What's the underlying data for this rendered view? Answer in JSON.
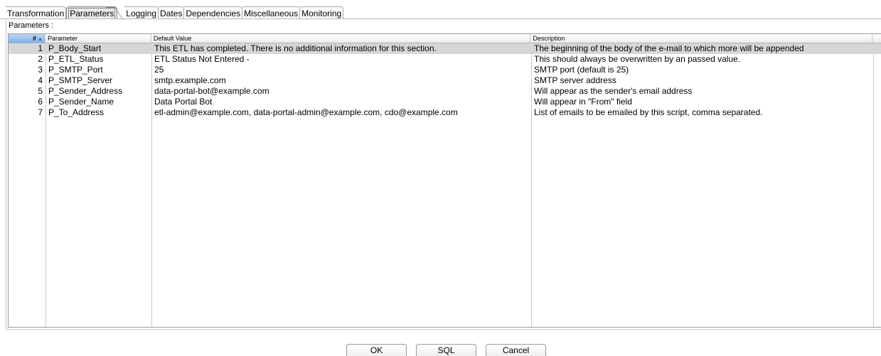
{
  "tabs": [
    {
      "label": "Transformation",
      "active": false
    },
    {
      "label": "Parameters",
      "active": true
    },
    {
      "label": "Logging",
      "active": false
    },
    {
      "label": "Dates",
      "active": false
    },
    {
      "label": "Dependencies",
      "active": false
    },
    {
      "label": "Miscellaneous",
      "active": false
    },
    {
      "label": "Monitoring",
      "active": false
    }
  ],
  "panel": {
    "label": "Parameters :"
  },
  "table": {
    "columns": {
      "num": "#",
      "sort_indicator": "▲",
      "param": "Parameter",
      "default": "Default Value",
      "desc": "Description"
    },
    "rows": [
      {
        "num": "1",
        "param": "P_Body_Start",
        "default": "This ETL has completed.  There is no additional information for this section.",
        "desc": "The beginning of the body of the e-mail to which more will be appended",
        "selected": true
      },
      {
        "num": "2",
        "param": "P_ETL_Status",
        "default": "ETL Status Not Entered -",
        "desc": "This should always be overwritten by an passed value.",
        "selected": false
      },
      {
        "num": "3",
        "param": "P_SMTP_Port",
        "default": "25",
        "desc": "SMTP port (default is 25)",
        "selected": false
      },
      {
        "num": "4",
        "param": "P_SMTP_Server",
        "default": "smtp.example.com",
        "desc": "SMTP server address",
        "selected": false
      },
      {
        "num": "5",
        "param": "P_Sender_Address",
        "default": "data-portal-bot@example.com",
        "desc": "Will appear as the sender's email address",
        "selected": false
      },
      {
        "num": "6",
        "param": "P_Sender_Name",
        "default": "Data Portal Bot",
        "desc": "Will appear in \"From\" field",
        "selected": false
      },
      {
        "num": "7",
        "param": "P_To_Address",
        "default": "etl-admin@example.com, data-portal-admin@example.com, cdo@example.com",
        "desc": "List of emails to be emailed by this script, comma separated.",
        "selected": false
      }
    ]
  },
  "buttons": {
    "ok": "OK",
    "sql": "SQL",
    "cancel": "Cancel"
  }
}
